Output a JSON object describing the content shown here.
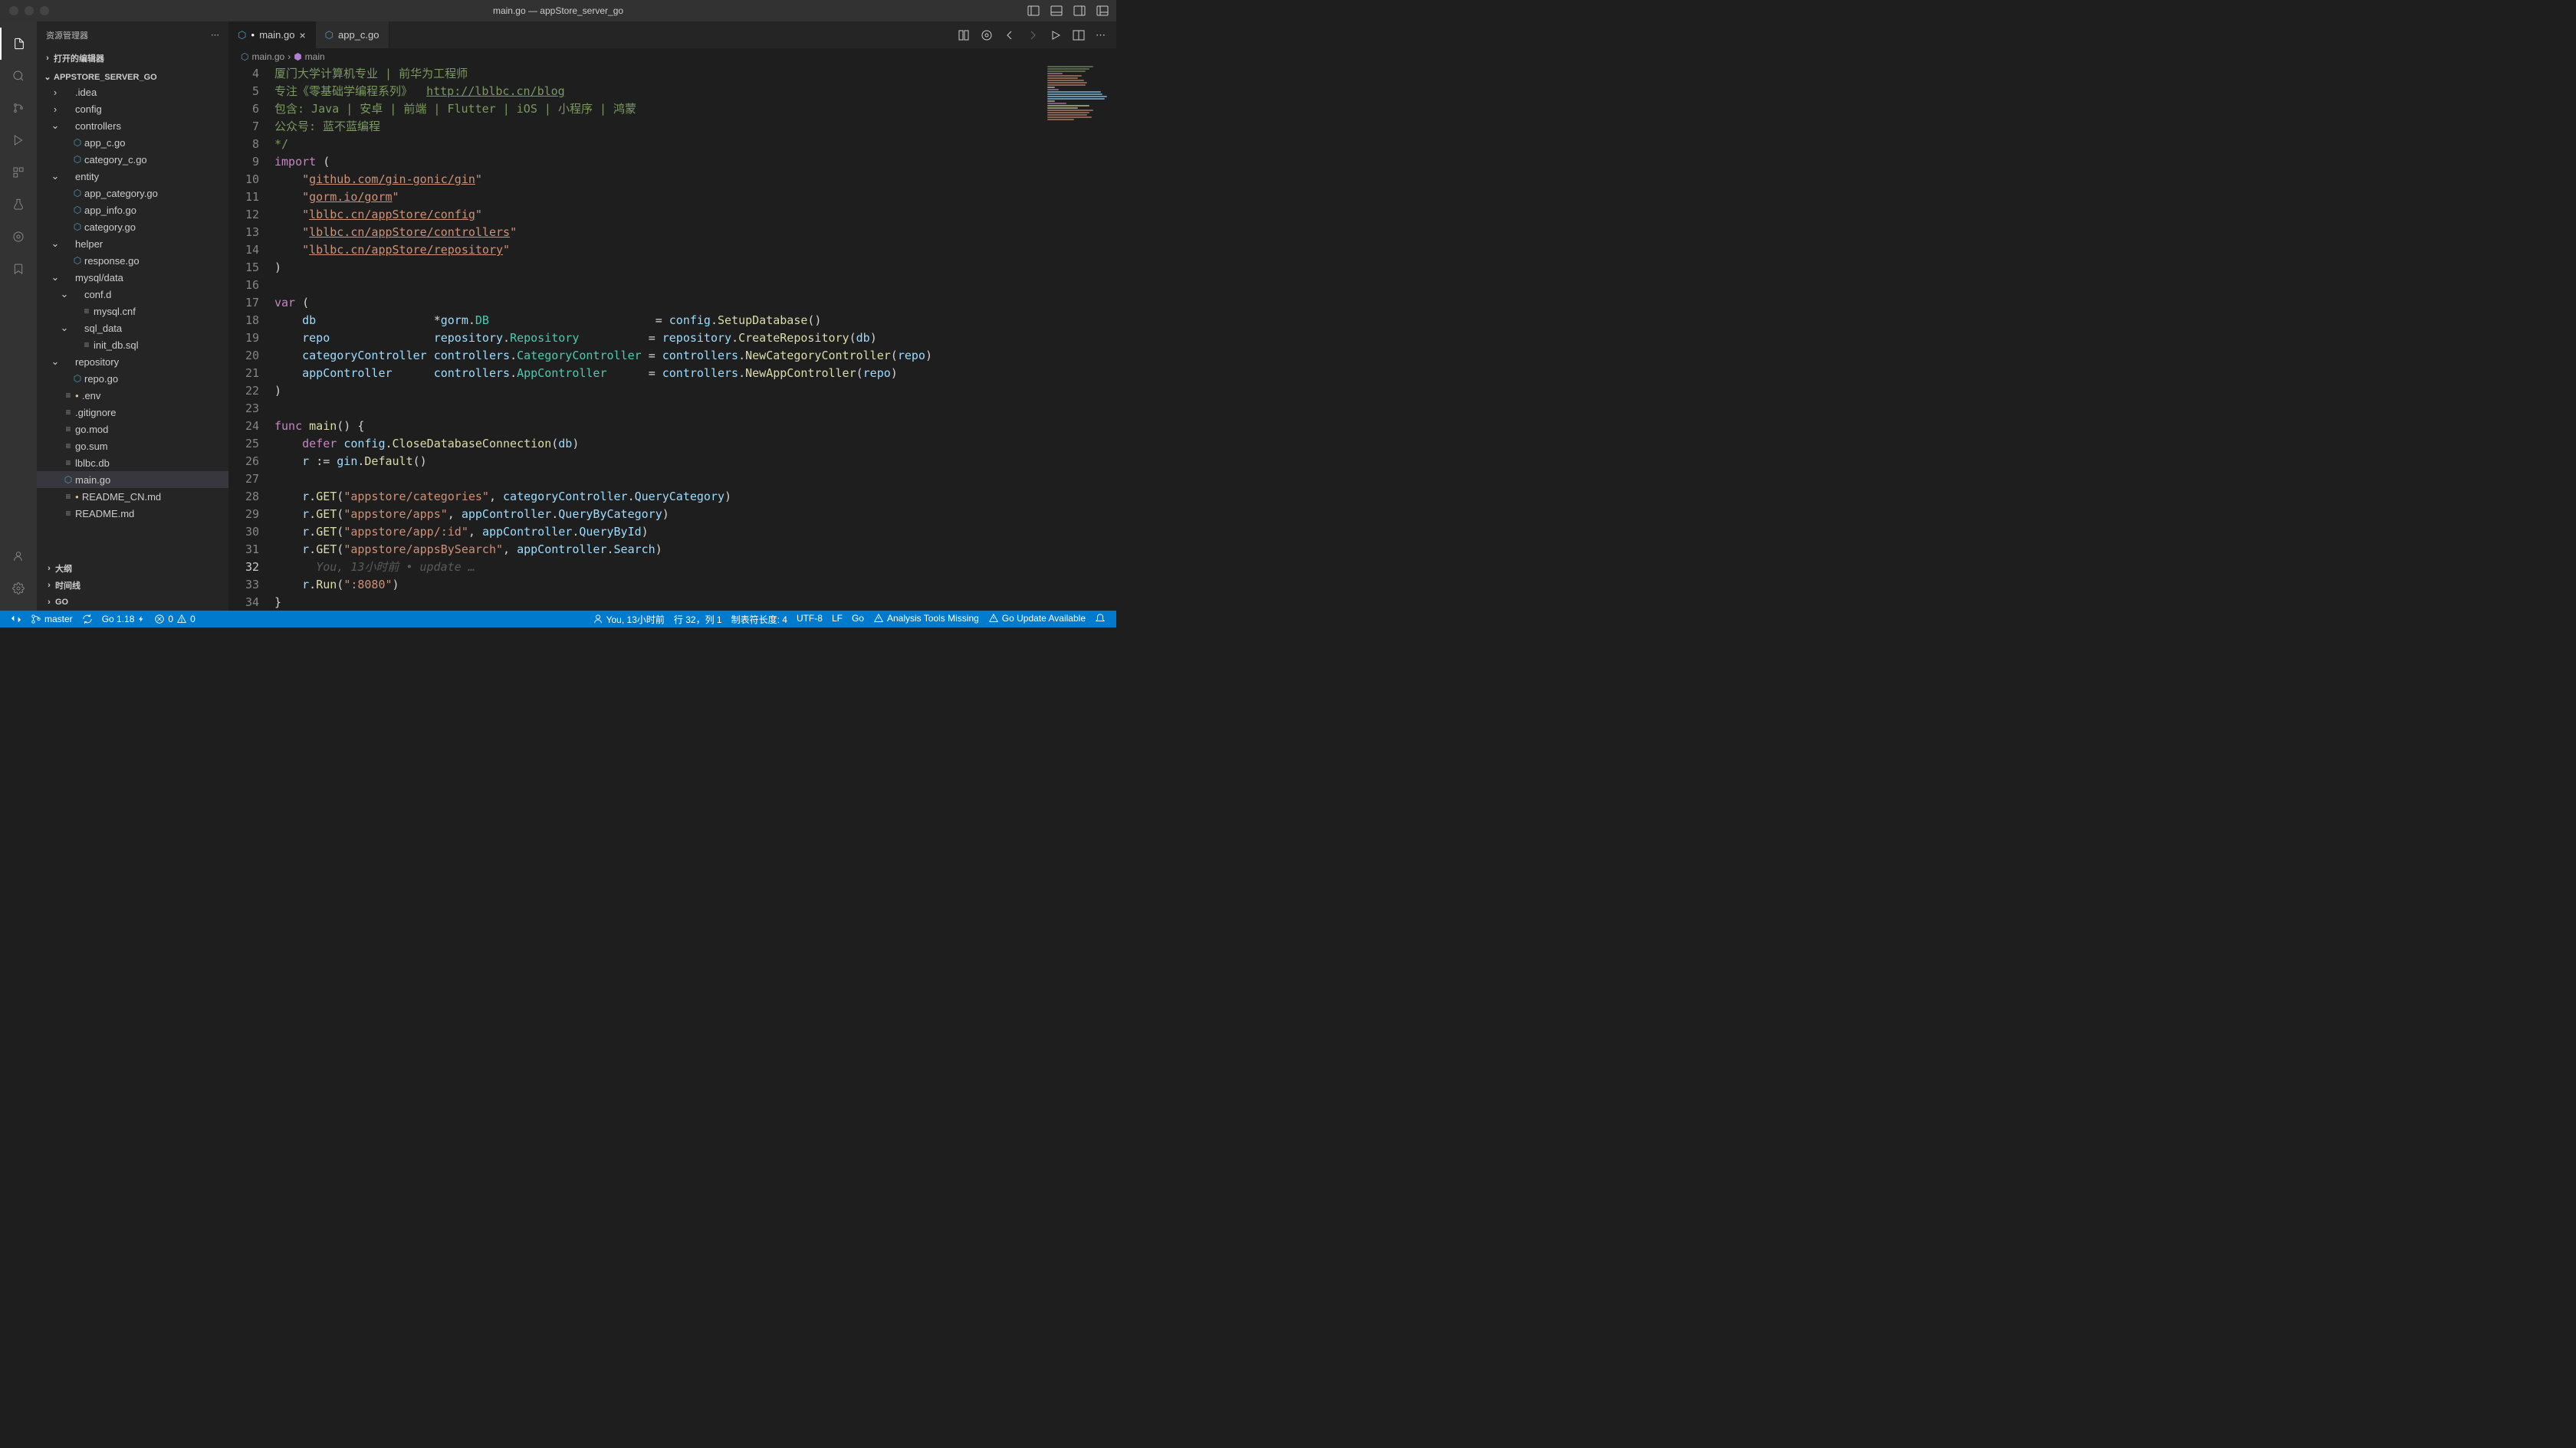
{
  "window": {
    "title": "main.go — appStore_server_go"
  },
  "sidebar": {
    "title": "资源管理器",
    "sections": {
      "openEditors": "打开的编辑器",
      "root": "APPSTORE_SERVER_GO",
      "outline": "大纲",
      "timeline": "时间线",
      "go": "GO"
    },
    "tree": [
      {
        "name": ".idea",
        "type": "folder",
        "depth": 1
      },
      {
        "name": "config",
        "type": "folder",
        "depth": 1
      },
      {
        "name": "controllers",
        "type": "folder",
        "depth": 1,
        "open": true
      },
      {
        "name": "app_c.go",
        "type": "go",
        "depth": 2
      },
      {
        "name": "category_c.go",
        "type": "go",
        "depth": 2
      },
      {
        "name": "entity",
        "type": "folder",
        "depth": 1,
        "open": true
      },
      {
        "name": "app_category.go",
        "type": "go",
        "depth": 2
      },
      {
        "name": "app_info.go",
        "type": "go",
        "depth": 2
      },
      {
        "name": "category.go",
        "type": "go",
        "depth": 2
      },
      {
        "name": "helper",
        "type": "folder",
        "depth": 1,
        "open": true
      },
      {
        "name": "response.go",
        "type": "go",
        "depth": 2
      },
      {
        "name": "mysql/data",
        "type": "folder",
        "depth": 1,
        "open": true
      },
      {
        "name": "conf.d",
        "type": "folder",
        "depth": 2,
        "open": true
      },
      {
        "name": "mysql.cnf",
        "type": "file",
        "depth": 3
      },
      {
        "name": "sql_data",
        "type": "folder",
        "depth": 2,
        "open": true
      },
      {
        "name": "init_db.sql",
        "type": "file",
        "depth": 3
      },
      {
        "name": "repository",
        "type": "folder",
        "depth": 1,
        "open": true
      },
      {
        "name": "repo.go",
        "type": "go",
        "depth": 2
      },
      {
        "name": ".env",
        "type": "file",
        "depth": 1,
        "mod": true
      },
      {
        "name": ".gitignore",
        "type": "file",
        "depth": 1
      },
      {
        "name": "go.mod",
        "type": "file",
        "depth": 1
      },
      {
        "name": "go.sum",
        "type": "file",
        "depth": 1
      },
      {
        "name": "lblbc.db",
        "type": "file",
        "depth": 1
      },
      {
        "name": "main.go",
        "type": "go",
        "depth": 1,
        "selected": true
      },
      {
        "name": "README_CN.md",
        "type": "file",
        "depth": 1,
        "mod": true
      },
      {
        "name": "README.md",
        "type": "file",
        "depth": 1
      }
    ]
  },
  "tabs": [
    {
      "name": "main.go",
      "active": true,
      "icon": "go",
      "dirty": true
    },
    {
      "name": "app_c.go",
      "active": false,
      "icon": "go"
    }
  ],
  "breadcrumb": {
    "file": "main.go",
    "symbol": "main"
  },
  "code": {
    "startLine": 4,
    "lines": [
      {
        "n": 4,
        "html": "<span class='s-comment'>厦门大学计算机专业 | 前华为工程师</span>"
      },
      {
        "n": 5,
        "html": "<span class='s-comment'>专注《零基础学编程系列》  </span><span class='s-linkc'>http://lblbc.cn/blog</span>"
      },
      {
        "n": 6,
        "html": "<span class='s-comment'>包含: Java | 安卓 | 前端 | Flutter | iOS | 小程序 | 鸿蒙</span>"
      },
      {
        "n": 7,
        "html": "<span class='s-comment'>公众号: 蓝不蓝编程</span>"
      },
      {
        "n": 8,
        "html": "<span class='s-comment'>*/</span>"
      },
      {
        "n": 9,
        "html": "<span class='s-keyword'>import</span> <span class='s-punct'>(</span>"
      },
      {
        "n": 10,
        "html": "    <span class='s-string'>\"</span><span class='s-link'>github.com/gin-gonic/gin</span><span class='s-string'>\"</span>"
      },
      {
        "n": 11,
        "html": "    <span class='s-string'>\"</span><span class='s-link'>gorm.io/gorm</span><span class='s-string'>\"</span>"
      },
      {
        "n": 12,
        "html": "    <span class='s-string'>\"</span><span class='s-link'>lblbc.cn/appStore/config</span><span class='s-string'>\"</span>"
      },
      {
        "n": 13,
        "html": "    <span class='s-string'>\"</span><span class='s-link'>lblbc.cn/appStore/controllers</span><span class='s-string'>\"</span>"
      },
      {
        "n": 14,
        "html": "    <span class='s-string'>\"</span><span class='s-link'>lblbc.cn/appStore/repository</span><span class='s-string'>\"</span>"
      },
      {
        "n": 15,
        "html": "<span class='s-punct'>)</span>"
      },
      {
        "n": 16,
        "html": ""
      },
      {
        "n": 17,
        "html": "<span class='s-keyword'>var</span> <span class='s-punct'>(</span>"
      },
      {
        "n": 18,
        "html": "    <span class='s-ident'>db</span>                 <span class='s-op'>*</span><span class='s-ident'>gorm</span><span class='s-punct'>.</span><span class='s-type'>DB</span>                        <span class='s-op'>=</span> <span class='s-ident'>config</span><span class='s-punct'>.</span><span class='s-func'>SetupDatabase</span><span class='s-punct'>()</span>"
      },
      {
        "n": 19,
        "html": "    <span class='s-ident'>repo</span>               <span class='s-ident'>repository</span><span class='s-punct'>.</span><span class='s-type'>Repository</span>          <span class='s-op'>=</span> <span class='s-ident'>repository</span><span class='s-punct'>.</span><span class='s-func'>CreateRepository</span><span class='s-punct'>(</span><span class='s-ident'>db</span><span class='s-punct'>)</span>"
      },
      {
        "n": 20,
        "html": "    <span class='s-ident'>categoryController</span> <span class='s-ident'>controllers</span><span class='s-punct'>.</span><span class='s-type'>CategoryController</span> <span class='s-op'>=</span> <span class='s-ident'>controllers</span><span class='s-punct'>.</span><span class='s-func'>NewCategoryController</span><span class='s-punct'>(</span><span class='s-ident'>repo</span><span class='s-punct'>)</span>"
      },
      {
        "n": 21,
        "html": "    <span class='s-ident'>appController</span>      <span class='s-ident'>controllers</span><span class='s-punct'>.</span><span class='s-type'>AppController</span>      <span class='s-op'>=</span> <span class='s-ident'>controllers</span><span class='s-punct'>.</span><span class='s-func'>NewAppController</span><span class='s-punct'>(</span><span class='s-ident'>repo</span><span class='s-punct'>)</span>"
      },
      {
        "n": 22,
        "html": "<span class='s-punct'>)</span>"
      },
      {
        "n": 23,
        "html": ""
      },
      {
        "n": 24,
        "html": "<span class='s-keyword'>func</span> <span class='s-func'>main</span><span class='s-punct'>()</span> <span class='s-punct'>{</span>"
      },
      {
        "n": 25,
        "html": "    <span class='s-keyword'>defer</span> <span class='s-ident'>config</span><span class='s-punct'>.</span><span class='s-func'>CloseDatabaseConnection</span><span class='s-punct'>(</span><span class='s-ident'>db</span><span class='s-punct'>)</span>"
      },
      {
        "n": 26,
        "html": "    <span class='s-ident'>r</span> <span class='s-op'>:=</span> <span class='s-ident'>gin</span><span class='s-punct'>.</span><span class='s-func'>Default</span><span class='s-punct'>()</span>"
      },
      {
        "n": 27,
        "html": ""
      },
      {
        "n": 28,
        "html": "    <span class='s-ident'>r</span><span class='s-punct'>.</span><span class='s-func'>GET</span><span class='s-punct'>(</span><span class='s-string'>\"appstore/categories\"</span><span class='s-punct'>,</span> <span class='s-ident'>categoryController</span><span class='s-punct'>.</span><span class='s-ident'>QueryCategory</span><span class='s-punct'>)</span>"
      },
      {
        "n": 29,
        "html": "    <span class='s-ident'>r</span><span class='s-punct'>.</span><span class='s-func'>GET</span><span class='s-punct'>(</span><span class='s-string'>\"appstore/apps\"</span><span class='s-punct'>,</span> <span class='s-ident'>appController</span><span class='s-punct'>.</span><span class='s-ident'>QueryByCategory</span><span class='s-punct'>)</span>"
      },
      {
        "n": 30,
        "html": "    <span class='s-ident'>r</span><span class='s-punct'>.</span><span class='s-func'>GET</span><span class='s-punct'>(</span><span class='s-string'>\"appstore/app/:id\"</span><span class='s-punct'>,</span> <span class='s-ident'>appController</span><span class='s-punct'>.</span><span class='s-ident'>QueryById</span><span class='s-punct'>)</span>"
      },
      {
        "n": 31,
        "html": "    <span class='s-ident'>r</span><span class='s-punct'>.</span><span class='s-func'>GET</span><span class='s-punct'>(</span><span class='s-string'>\"appstore/appsBySearch\"</span><span class='s-punct'>,</span> <span class='s-ident'>appController</span><span class='s-punct'>.</span><span class='s-ident'>Search</span><span class='s-punct'>)</span>"
      },
      {
        "n": 32,
        "html": "      <span class='s-gitlens'>You, 13小时前 • update …</span>",
        "current": true
      },
      {
        "n": 33,
        "html": "    <span class='s-ident'>r</span><span class='s-punct'>.</span><span class='s-func'>Run</span><span class='s-punct'>(</span><span class='s-string'>\":8080\"</span><span class='s-punct'>)</span>"
      },
      {
        "n": 34,
        "html": "<span class='s-punct'>}</span>"
      },
      {
        "n": 35,
        "html": ""
      }
    ]
  },
  "statusBar": {
    "branch": "master",
    "sync": "",
    "goVersion": "Go 1.18",
    "errors": "0",
    "warnings": "0",
    "blame": "You, 13小时前",
    "cursor": "行 32，列 1",
    "tabSize": "制表符长度: 4",
    "encoding": "UTF-8",
    "eol": "LF",
    "lang": "Go",
    "analysis": "Analysis Tools Missing",
    "goUpdate": "Go Update Available"
  }
}
